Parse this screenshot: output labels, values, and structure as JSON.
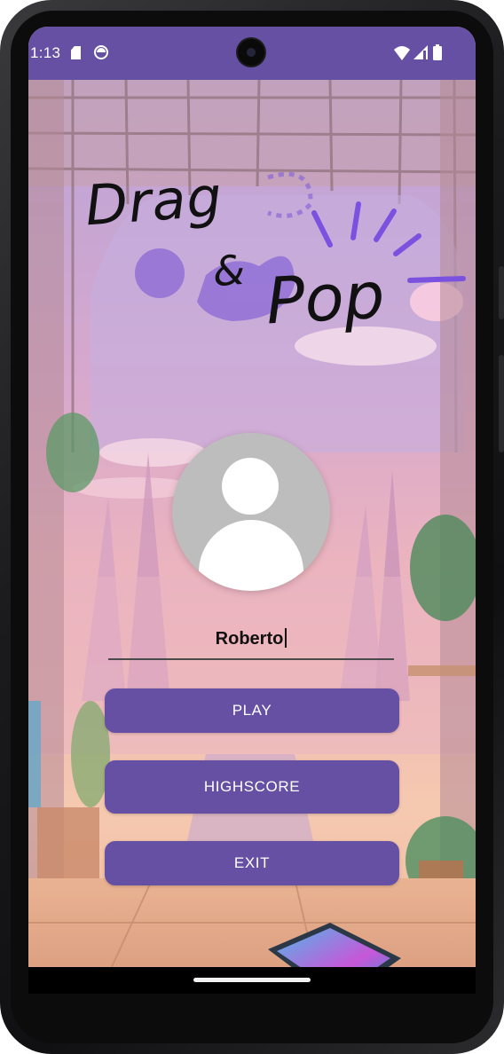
{
  "status_bar": {
    "time": "1:13",
    "left_icons": [
      "sd-card-icon",
      "face-status-icon"
    ],
    "right_icons": [
      "wifi-icon",
      "cell-signal-icon",
      "battery-icon"
    ],
    "color": "#6650a4"
  },
  "app": {
    "logo_text": {
      "word1": "Drag",
      "word2": "&",
      "word3": "Pop"
    },
    "avatar_icon": "person-placeholder-icon",
    "name_field": {
      "value": "Roberto"
    },
    "buttons": {
      "play": "PLAY",
      "highscore": "HIGHSCORE",
      "exit": "EXIT"
    },
    "accent_color": "#6650a4"
  },
  "nav": {
    "home_indicator": "home-gesture-pill"
  }
}
